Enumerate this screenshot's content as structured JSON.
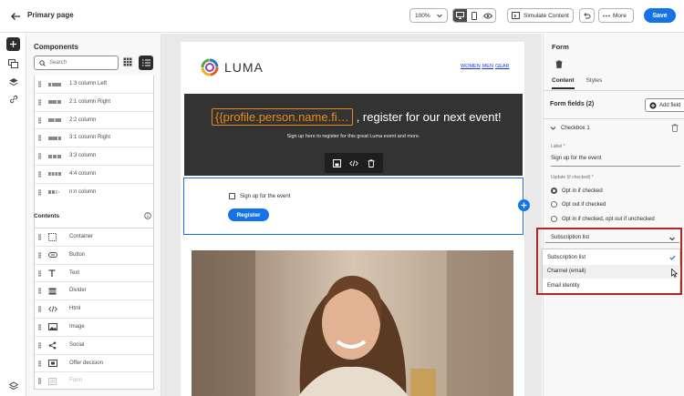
{
  "header": {
    "title": "Primary page",
    "zoom": "100%",
    "simulate_label": "Simulate Content",
    "more_label": "More",
    "save_label": "Save"
  },
  "components": {
    "title": "Components",
    "search_placeholder": "Search",
    "layouts": [
      "1:3 column Left",
      "2:1 column Right",
      "2:2 column",
      "3:1 column Right",
      "3:3 column",
      "4:4 column",
      "n:n column"
    ],
    "contents_title": "Contents",
    "contents": [
      "Container",
      "Button",
      "Text",
      "Divider",
      "Html",
      "Image",
      "Social",
      "Offer decision",
      "Form"
    ]
  },
  "email": {
    "brand": "LUMA",
    "nav": [
      "WOMEN",
      "MEN",
      "GEAR"
    ],
    "hero_token": "{{profile.person.name.fi…",
    "hero_text": ", register for our next event!",
    "hero_sub": "Sign up here to register for this great Luma event and more.",
    "checkbox_label": "Sign up for the event",
    "register_label": "Register"
  },
  "properties": {
    "title": "Form",
    "tabs": [
      "Content",
      "Styles"
    ],
    "form_fields_title": "Form fields (2)",
    "add_field_label": "Add field",
    "checkbox_item": "Checkbox 1",
    "label_caption": "Label",
    "label_value": "Sign up for the event",
    "update_caption": "Update (if checked)",
    "radios": [
      "Opt in if checked",
      "Opt out if checked",
      "Opt in if checked, opt out if unchecked"
    ],
    "selected_radio": 0,
    "select_value": "Subscription list",
    "options": [
      "Subscription list",
      "Channel (email)",
      "Email identity"
    ],
    "highlight_color": "#b32626",
    "accent_color": "#1473e6"
  }
}
